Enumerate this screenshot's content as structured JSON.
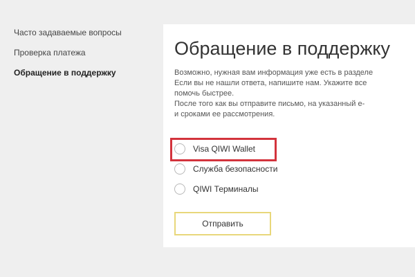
{
  "sidebar": {
    "items": [
      {
        "label": "Часто задаваемые вопросы"
      },
      {
        "label": "Проверка платежа"
      },
      {
        "label": "Обращение в поддержку"
      }
    ]
  },
  "main": {
    "title": "Обращение в поддержку",
    "intro_lines": [
      "Возможно, нужная вам информация уже есть в разделе",
      "Если вы не нашли ответа, напишите нам. Укажите все",
      "помочь быстрее.",
      "После того как вы отправите письмо, на указанный e-",
      "и сроками ее рассмотрения."
    ],
    "options": [
      {
        "label": "Visa QIWI Wallet"
      },
      {
        "label": "Служба безопасности"
      },
      {
        "label": "QIWI Терминалы"
      }
    ],
    "submit_label": "Отправить"
  },
  "colors": {
    "highlight": "#d3333c",
    "button_border": "#e8d77a",
    "background": "#efefef"
  }
}
